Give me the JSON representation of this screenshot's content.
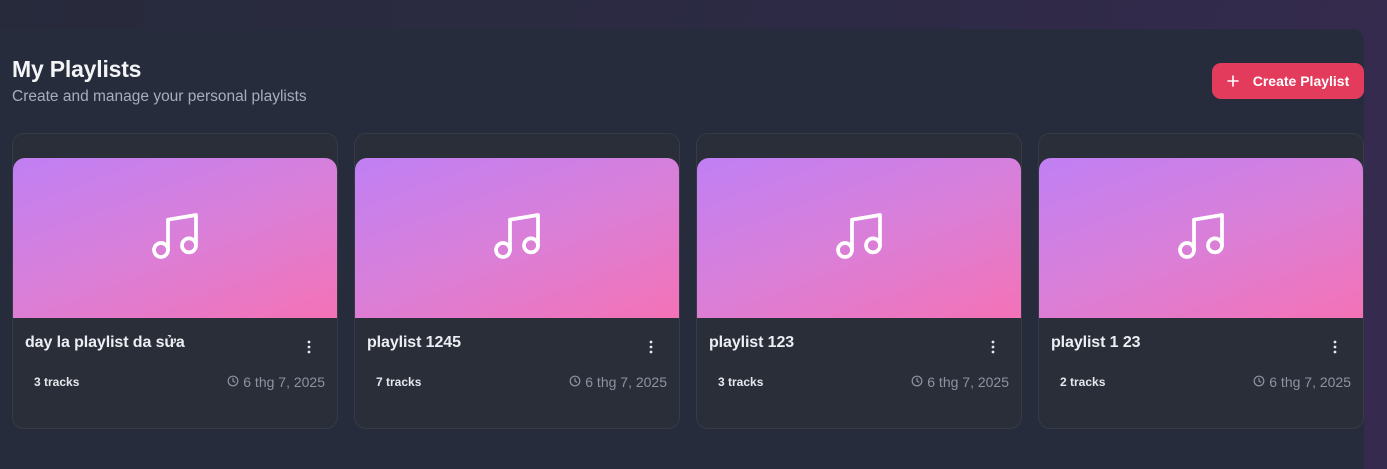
{
  "header": {
    "title": "My Playlists",
    "subtitle": "Create and manage your personal playlists"
  },
  "actions": {
    "create_label": "Create Playlist"
  },
  "colors": {
    "accent": "#e23b5c",
    "cover_gradient_start": "#c07ff4",
    "cover_gradient_end": "#f472b6"
  },
  "playlists": [
    {
      "name": "day la playlist da sửa",
      "tracks": "3 tracks",
      "date": "6 thg 7, 2025",
      "icon": "music-note-icon"
    },
    {
      "name": "playlist 1245",
      "tracks": "7 tracks",
      "date": "6 thg 7, 2025",
      "icon": "music-note-icon"
    },
    {
      "name": "playlist 123",
      "tracks": "3 tracks",
      "date": "6 thg 7, 2025",
      "icon": "music-note-icon"
    },
    {
      "name": "playlist 1 23",
      "tracks": "2 tracks",
      "date": "6 thg 7, 2025",
      "icon": "music-note-icon"
    }
  ]
}
